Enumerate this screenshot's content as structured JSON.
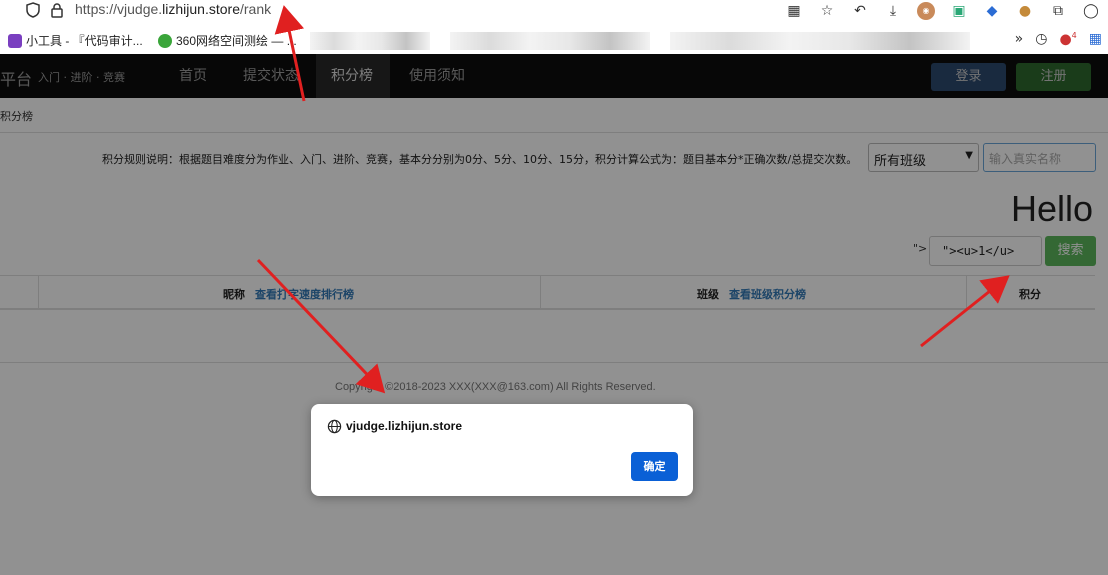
{
  "browser": {
    "url_prefix": "https://vjudge.",
    "url_host": "lizhijun.store",
    "url_path": "/rank",
    "bookmarks": [
      {
        "label": "小工具 - 『代码审计..."
      },
      {
        "label": "360网络空间测绘 — ..."
      }
    ],
    "toolbar_icons": [
      "qr-icon",
      "star-icon",
      "back-icon",
      "download-icon",
      "extension-icon",
      "code-icon",
      "tag-icon",
      "cookie-icon",
      "puzzle-icon",
      "account-icon"
    ],
    "bookmark_badge": "4"
  },
  "site": {
    "brand": "平台",
    "brand_sub": "入门 · 进阶 · 竞赛",
    "nav": [
      "首页",
      "提交状态",
      "积分榜",
      "使用须知"
    ],
    "login": "登录",
    "register": "注册"
  },
  "page": {
    "breadcrumb": "积分榜",
    "rules": "积分规则说明：根据题目难度分为作业、入门、进阶、竞赛，基本分分别为0分、5分、10分、15分，积分计算公式为：题目基本分*正确次数/总提交次数。",
    "class_select": "所有班级",
    "name_placeholder": "输入真实名称",
    "hello": "Hello",
    "xss_prefix": "\">",
    "search_value": "\"><u>1</u>",
    "search_button": "搜索",
    "table": {
      "col_nickname": "昵称",
      "col_nickname_link": "查看打字速度排行榜",
      "col_class": "班级",
      "col_class_link": "查看班级积分榜",
      "col_score": "积分"
    },
    "copyright": "Copyright ©2018-2023 XXX(XXX@163.com) All Rights Reserved."
  },
  "dialog": {
    "title": "vjudge.lizhijun.store",
    "ok": "确定"
  }
}
